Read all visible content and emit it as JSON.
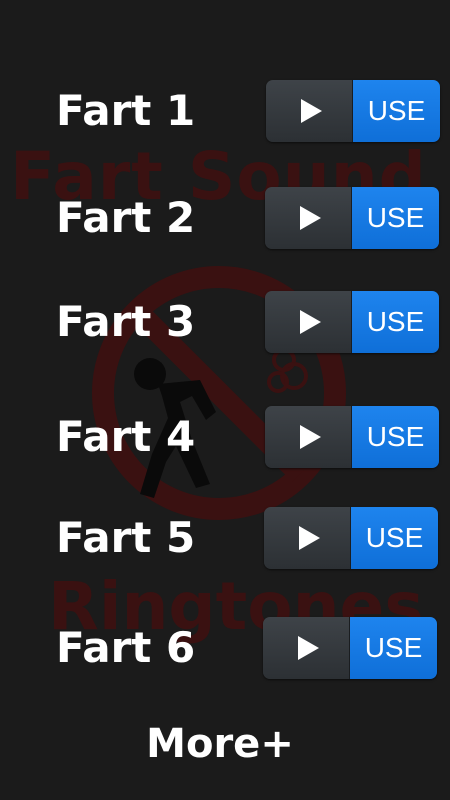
{
  "watermark": {
    "title": "Fart Sound",
    "subtitle": "Ringtones"
  },
  "sounds": [
    {
      "label": "Fart 1",
      "play_icon": "play-icon",
      "use_label": "USE"
    },
    {
      "label": "Fart 2",
      "play_icon": "play-icon",
      "use_label": "USE"
    },
    {
      "label": "Fart 3",
      "play_icon": "play-icon",
      "use_label": "USE"
    },
    {
      "label": "Fart 4",
      "play_icon": "play-icon",
      "use_label": "USE"
    },
    {
      "label": "Fart 5",
      "play_icon": "play-icon",
      "use_label": "USE"
    },
    {
      "label": "Fart 6",
      "play_icon": "play-icon",
      "use_label": "USE"
    }
  ],
  "footer": {
    "more_label": "More+"
  },
  "colors": {
    "background": "#1b1b1b",
    "watermark": "#3a1111",
    "use_button": "#1a7ce8",
    "play_button": "#353a3f",
    "text": "#ffffff"
  }
}
